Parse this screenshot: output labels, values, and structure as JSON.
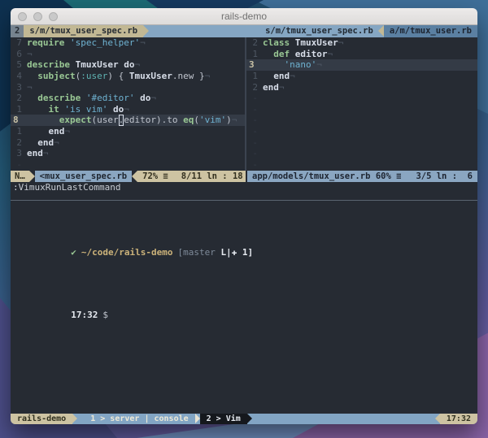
{
  "window": {
    "title": "rails-demo"
  },
  "tabline": {
    "left_tab_number": "2",
    "left_tab_label": "s/m/tmux_user_spec.rb",
    "right_tab1": "s/m/tmux_user_spec.rb",
    "right_tab2": "a/m/tmux_user.rb"
  },
  "panes": {
    "left": {
      "lines": [
        {
          "g": "7",
          "s": [
            [
              "kw",
              "require"
            ],
            [
              "pl",
              " "
            ],
            [
              "str",
              "'spec_helper'"
            ],
            [
              "eol",
              "¬"
            ]
          ]
        },
        {
          "g": "6",
          "s": [
            [
              "eol",
              "¬"
            ]
          ]
        },
        {
          "g": "5",
          "s": [
            [
              "kw",
              "describe"
            ],
            [
              "pl",
              " "
            ],
            [
              "bw",
              "TmuxUser"
            ],
            [
              "pl",
              " "
            ],
            [
              "bw",
              "do"
            ],
            [
              "eol",
              "¬"
            ]
          ]
        },
        {
          "g": "4",
          "s": [
            [
              "pl",
              "  "
            ],
            [
              "kw",
              "subject"
            ],
            [
              "pl",
              "("
            ],
            [
              "sym",
              ":user"
            ],
            [
              "pl",
              ") { "
            ],
            [
              "bw",
              "TmuxUser"
            ],
            [
              "pl",
              ".new }"
            ],
            [
              "eol",
              "¬"
            ]
          ]
        },
        {
          "g": "3",
          "s": [
            [
              "eol",
              "¬"
            ]
          ]
        },
        {
          "g": "2",
          "s": [
            [
              "pl",
              "  "
            ],
            [
              "kw",
              "describe"
            ],
            [
              "pl",
              " "
            ],
            [
              "str",
              "'#editor'"
            ],
            [
              "pl",
              " "
            ],
            [
              "bw",
              "do"
            ],
            [
              "eol",
              "¬"
            ]
          ]
        },
        {
          "g": "1",
          "s": [
            [
              "pl",
              "    "
            ],
            [
              "kw",
              "it"
            ],
            [
              "pl",
              " "
            ],
            [
              "str",
              "'is vim'"
            ],
            [
              "pl",
              " "
            ],
            [
              "bw",
              "do"
            ],
            [
              "eol",
              "¬"
            ]
          ]
        },
        {
          "g": "8",
          "cur": true,
          "s": [
            [
              "pl",
              "      "
            ],
            [
              "kw",
              "expect"
            ],
            [
              "pl",
              "(user"
            ],
            [
              "cursor",
              "."
            ],
            [
              "pl",
              "editor).to "
            ],
            [
              "kw",
              "eq"
            ],
            [
              "pl",
              "("
            ],
            [
              "str",
              "'vim'"
            ],
            [
              "pl",
              ")"
            ],
            [
              "eol",
              "¬"
            ]
          ]
        },
        {
          "g": "1",
          "s": [
            [
              "pl",
              "    "
            ],
            [
              "bw",
              "end"
            ],
            [
              "eol",
              "¬"
            ]
          ]
        },
        {
          "g": "2",
          "s": [
            [
              "pl",
              "  "
            ],
            [
              "bw",
              "end"
            ],
            [
              "eol",
              "¬"
            ]
          ]
        },
        {
          "g": "3",
          "s": [
            [
              "bw",
              "end"
            ],
            [
              "eol",
              "¬"
            ]
          ]
        },
        {
          "g": "-",
          "s": []
        }
      ]
    },
    "right": {
      "lines": [
        {
          "g": "2",
          "s": [
            [
              "kw",
              "class"
            ],
            [
              "pl",
              " "
            ],
            [
              "bw",
              "TmuxUser"
            ],
            [
              "eol",
              "¬"
            ]
          ]
        },
        {
          "g": "1",
          "s": [
            [
              "pl",
              "  "
            ],
            [
              "kw",
              "def"
            ],
            [
              "pl",
              " "
            ],
            [
              "bw",
              "editor"
            ],
            [
              "eol",
              "¬"
            ]
          ]
        },
        {
          "g": "3",
          "cur": true,
          "s": [
            [
              "pl",
              "    "
            ],
            [
              "str",
              "'nano'"
            ],
            [
              "eol",
              "¬"
            ]
          ]
        },
        {
          "g": "1",
          "s": [
            [
              "pl",
              "  "
            ],
            [
              "bw",
              "end"
            ],
            [
              "eol",
              "¬"
            ]
          ]
        },
        {
          "g": "2",
          "s": [
            [
              "bw",
              "end"
            ],
            [
              "eol",
              "¬"
            ]
          ]
        },
        {
          "g": "-",
          "s": []
        },
        {
          "g": "-",
          "s": []
        },
        {
          "g": "-",
          "s": []
        },
        {
          "g": "-",
          "s": []
        },
        {
          "g": "-",
          "s": []
        },
        {
          "g": "-",
          "s": []
        },
        {
          "g": "-",
          "s": []
        }
      ]
    }
  },
  "statusline_left": {
    "mode": "N…",
    "file": "<mux_user_spec.rb",
    "percent": "72% ≡",
    "position": "8/11 ln : 18"
  },
  "statusline_right": {
    "file": "app/models/tmux_user.rb",
    "percent": "60% ≡",
    "position": "3/5 ln :  6"
  },
  "cmdline": ":VimuxRunLastCommand",
  "shell": {
    "check": "✔",
    "path": "~/code/rails-demo",
    "branch_prefix": "[master ",
    "branch_flags": "L|",
    "branch_suffix": "✚ 1]",
    "prompt_time": "17:32",
    "prompt_symbol": "$"
  },
  "tmux_bar": {
    "session": "rails-demo",
    "window1": "1 > server | console",
    "window2": "2 > Vim",
    "time": "17:32"
  },
  "colors": {
    "terminal_bg": "#262b33",
    "khaki_accent": "#cdc3a2",
    "powder_blue": "#85a6c3",
    "steel_blue": "#5b80a2",
    "active_window_black": "#15181d",
    "keyword_green": "#99c794",
    "string_cyan": "#6fb3d2",
    "current_line_bg": "#343b46"
  }
}
